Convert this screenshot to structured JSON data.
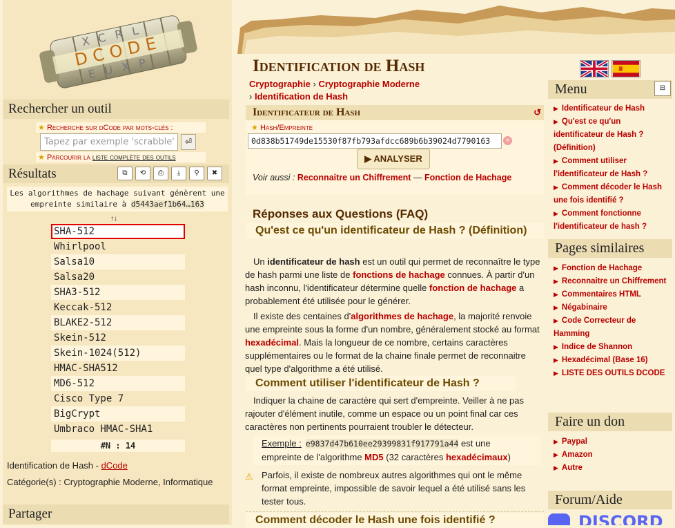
{
  "left": {
    "search_title": "Rechercher un outil",
    "search_keywords_label": "Recherche sur dCode par mots-clés :",
    "search_placeholder": "Tapez par exemple 'scrabble'",
    "tools_link_prefix": "Parcourir la",
    "tools_link_text": "liste complète des outils",
    "results_title": "Résultats",
    "results_desc_1": "Les algorithmes de hachage suivant génèrent une",
    "results_desc_2": "empreinte similaire à",
    "results_desc_code": "d5443aef1b64…163",
    "sort_arrows": "↑↓",
    "results": [
      "SHA-512",
      "Whirlpool",
      "Salsa10",
      "Salsa20",
      "SHA3-512",
      "Keccak-512",
      "BLAKE2-512",
      "Skein-512",
      "Skein-1024(512)",
      "HMAC-SHA512",
      "MD6-512",
      "Cisco Type 7",
      "BigCrypt",
      "Umbraco HMAC-SHA1"
    ],
    "results_count": "#N : 14",
    "meta_title": "Identification de Hash - ",
    "meta_title_link": "dCode",
    "meta_categories": "Catégorie(s) : Cryptographie Moderne, Informatique",
    "share_title": "Partager"
  },
  "main": {
    "title": "Identification de Hash",
    "breadcrumb": [
      "Cryptographie",
      "Cryptographie Moderne",
      "Identification de Hash"
    ],
    "tool_title": "Identificateur de Hash",
    "hash_label": "Hash/Empreinte",
    "hash_value": "0d838b51749de15530f87fb793afdcc689b6b39024d7790163",
    "analyse_label": "▶ ANALYSER",
    "see_also_label": "Voir aussi :",
    "see_also_1": "Reconnaitre un Chiffrement",
    "see_also_dash": "—",
    "see_also_2": "Fonction de Hachage",
    "faq_title": "Réponses aux Questions (FAQ)",
    "q1": "Qu'est ce qu'un identificateur de Hash ? (Définition)",
    "p1_a": "Un ",
    "p1_b": "identificateur de hash",
    "p1_c": " est un outil qui permet de reconnaître le type de hash parmi une liste de ",
    "p1_d": "fonctions de hachage",
    "p1_e": " connues. À partir d'un hash inconnu, l'identificateur détermine quelle ",
    "p1_f": "fonction de hachage",
    "p1_g": " a probablement été utilisée pour le générer.",
    "p2_a": "Il existe des centaines d'",
    "p2_b": "algorithmes de hachage",
    "p2_c": ", la majorité renvoie une empreinte sous la forme d'un nombre, généralement stocké au format ",
    "p2_d": "hexadécimal",
    "p2_e": ". Mais la longueur de ce nombre, certains caractères supplémentaires ou le format de la chaine finale permet de reconnaitre quel type d'algorithme a été utilisé.",
    "q2": "Comment utiliser l'identificateur de Hash ?",
    "p3": "Indiquer la chaine de caractère qui sert d'empreinte. Veiller à ne pas rajouter d'élément inutile, comme un espace ou un point final car ces caractères non pertinents pourraient troubler le détecteur.",
    "ex_label": "Exemple :",
    "ex_code": "e9837d47b610ee29399831f917791a44",
    "ex_a": " est une empreinte de l'algorithme ",
    "ex_b": "MD5",
    "ex_c": " (32 caractères ",
    "ex_d": "hexadécimaux",
    "ex_e": ")",
    "warn": "Parfois, il existe de nombreux autres algorithmes qui ont le même format empreinte, impossible de savoir lequel a été utilisé sans les tester tous.",
    "q3": "Comment décoder le Hash une fois identifié ?"
  },
  "right": {
    "menu_title": "Menu",
    "menu_items": [
      "Identificateur de Hash",
      "Qu'est ce qu'un identificateur de Hash ? (Définition)",
      "Comment utiliser l'identificateur de Hash ?",
      "Comment décoder le Hash une fois identifié ?",
      "Comment fonctionne l'identificateur de hash ?"
    ],
    "similar_title": "Pages similaires",
    "similar_items": [
      "Fonction de Hachage",
      "Reconnaitre un Chiffrement",
      "Commentaires HTML",
      "Négabinaire",
      "Code Correcteur de Hamming",
      "Indice de Shannon",
      "Hexadécimal (Base 16)",
      "LISTE DES OUTILS DCODE"
    ],
    "donate_title": "Faire un don",
    "donate_items": [
      "Paypal",
      "Amazon",
      "Autre"
    ],
    "forum_title": "Forum/Aide",
    "discord_text": "DISCORD"
  }
}
